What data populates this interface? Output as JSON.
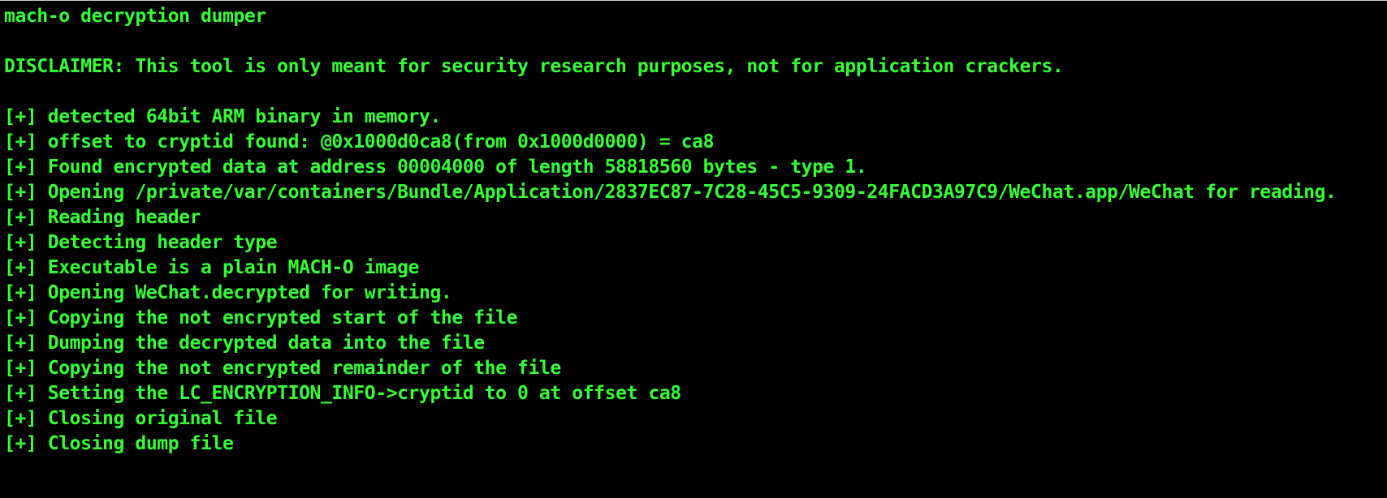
{
  "terminal": {
    "text_color": "#33ff33",
    "background": "#000000",
    "title_line": "mach-o decryption dumper",
    "disclaimer_line": "DISCLAIMER: This tool is only meant for security research purposes, not for application crackers.",
    "log_lines": [
      "[+] detected 64bit ARM binary in memory.",
      "[+] offset to cryptid found: @0x1000d0ca8(from 0x1000d0000) = ca8",
      "[+] Found encrypted data at address 00004000 of length 58818560 bytes - type 1.",
      "[+] Opening /private/var/containers/Bundle/Application/2837EC87-7C28-45C5-9309-24FACD3A97C9/WeChat.app/WeChat for reading.",
      "[+] Reading header",
      "[+] Detecting header type",
      "[+] Executable is a plain MACH-O image",
      "[+] Opening WeChat.decrypted for writing.",
      "[+] Copying the not encrypted start of the file",
      "[+] Dumping the decrypted data into the file",
      "[+] Copying the not encrypted remainder of the file",
      "[+] Setting the LC_ENCRYPTION_INFO->cryptid to 0 at offset ca8",
      "[+] Closing original file",
      "[+] Closing dump file"
    ]
  }
}
